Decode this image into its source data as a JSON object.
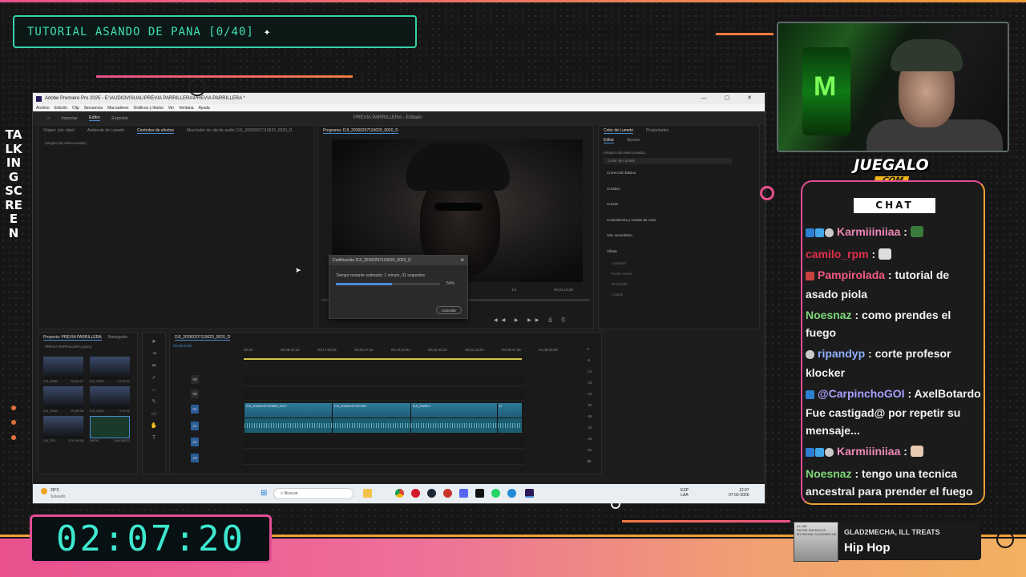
{
  "overlay": {
    "title": "TUTORIAL ASANDO DE PANA [0/40]",
    "title_icon": "sparkle-cursor-icon",
    "side_text": "TALKING SCREEN",
    "timer": "02:07:20",
    "brand_main": "JUEGALO",
    "brand_sub": ".COM",
    "colors": {
      "pink": "#e9508c",
      "orange": "#f0a038",
      "teal": "#3ee0b0"
    }
  },
  "premiere": {
    "window_title": "Adobe Premiere Pro 2025 - E:\\AUDIOVISUAL\\PREVIA PARRILLERA\\PREVIA PARRILLERA *",
    "menu": [
      "Archivo",
      "Edición",
      "Clip",
      "Secuencia",
      "Marcadores",
      "Gráficos y títulos",
      "Ver",
      "Ventana",
      "Ayuda"
    ],
    "workspace_tabs": [
      "Importar",
      "Editor",
      "Exportar"
    ],
    "active_workspace": "Editor",
    "project_title": "PREVIA PARRILLERA - Editado",
    "source_tabs": [
      "Origen: (sin clips)",
      "Ambiente de Lumetri",
      "Controles de efectos",
      "Mezclador de clip de audio: DJI_20260207110620_0020_D"
    ],
    "no_clip": "(ningún clip seleccionado)",
    "program_tab": "Programa: DJI_20260207110620_0020_D",
    "program_time": "00;01;19;38",
    "program_zoom": "1/2",
    "lumetri_tabs": [
      "Color de Lumetri",
      "Propiedades"
    ],
    "lumetri_subtabs": [
      "Editar",
      "Ajustes"
    ],
    "lumetri_no_clip": "(ningún clip seleccionado)",
    "lumetri_preset": "Color de Lumetri",
    "lumetri_sections": [
      "Corrección básica",
      "Creativo",
      "Curvas",
      "Coincidencia y ruedas de color",
      "HSL secundario",
      "Viñeta"
    ],
    "vignette_sliders": [
      "Cantidad",
      "Punto medio",
      "Redondez",
      "Calado"
    ],
    "project_panel": {
      "tab": "Proyecto: PREVIA PARRILLERA",
      "tab2": "Navegador",
      "file": "PREVIA PARRILLERA.prproj"
    },
    "bins": [
      {
        "name": "DJI_2026...",
        "dur": "33;40;10"
      },
      {
        "name": "DJI_2026...",
        "dur": "17;15;11"
      },
      {
        "name": "DJI_2026...",
        "dur": "20;40;38"
      },
      {
        "name": "DJI_2026...",
        "dur": "3;37;32"
      },
      {
        "name": "DJI_202...",
        "dur": "1;01;19;58"
      },
      {
        "name": "INFIN...",
        "dur": "3;46;08222"
      }
    ],
    "sequence_tab": "DJI_20260207110620_0020_D",
    "sequence_time": "00;00;00;00",
    "ruler": [
      "00;00",
      "00;08;32;32",
      "00;17;05;04",
      "00;25;37;32",
      "00;34;10;04",
      "00;42;42;32",
      "00;51;15;04",
      "00;59;47;36",
      "01;08;20;08"
    ],
    "tracks": [
      "V3",
      "V2",
      "V1",
      "A1",
      "A2",
      "A3"
    ],
    "clips": [
      "DJI_20260207100853_0017...",
      "DJI_20260207100753...",
      "DJI_202607...",
      "fx"
    ],
    "meter_labels": [
      "0",
      "-6",
      "-12",
      "-18",
      "-24",
      "-30",
      "-36",
      "-42",
      "-48",
      "-54",
      "dB"
    ],
    "dialog": {
      "title": "Codificación DJI_20260207110620_0020_D",
      "message": "Tiempo restante estimado: 1 minuto, 31 segundos",
      "percent": "54%",
      "progress": 0.54,
      "cancel": "Cancelar"
    },
    "taskbar": {
      "weather_temp": "28°C",
      "weather_desc": "Soleado",
      "search": "Buscar",
      "lang": "ESP",
      "lang2": "LAA",
      "time": "12:07",
      "date": "07-02-2026"
    }
  },
  "chat": {
    "header": "CHAT",
    "messages": [
      {
        "user": "Karmiiiniiaa",
        "color": "#f08ab8",
        "badges": [
          "b-prime",
          "b-cube",
          "b-skull"
        ],
        "text": "",
        "emote": "#3a7a3a"
      },
      {
        "user": "camilo_rpm",
        "color": "#e2304a",
        "badges": [],
        "text": "",
        "emote": "#dddddd"
      },
      {
        "user": "Pampirolada",
        "color": "#f25a80",
        "badges": [
          "b-mask"
        ],
        "text": "tutorial de asado piola",
        "emote": ""
      },
      {
        "user": "Noesnaz",
        "color": "#7fd87a",
        "badges": [],
        "text": "como prendes el fuego",
        "emote": ""
      },
      {
        "user": "ripandyp",
        "color": "#8fb0ff",
        "badges": [
          "b-skull"
        ],
        "text": "corte profesor klocker",
        "emote": ""
      },
      {
        "user": "@CarpinchoGOI",
        "color": "#a8a0ff",
        "badges": [
          "b-prime"
        ],
        "text": "AxelBotardo Fue castigad@ por repetir su mensaje...",
        "emote": ""
      },
      {
        "user": "Karmiiiniiaa",
        "color": "#f08ab8",
        "badges": [
          "b-prime",
          "b-cube",
          "b-skull"
        ],
        "text": "",
        "emote": "#e8c9b0"
      },
      {
        "user": "Noesnaz",
        "color": "#7fd87a",
        "badges": [],
        "text": "tengo una tecnica ancestral para prender el fuego",
        "emote": ""
      }
    ]
  },
  "music": {
    "artist": "GLAD2MECHA, ILL TREATS",
    "genre": "Hip Hop",
    "album_text": "ILL WE\nENTRE ENEMIGOS\nMYGRONE GLAD2MECHA"
  }
}
